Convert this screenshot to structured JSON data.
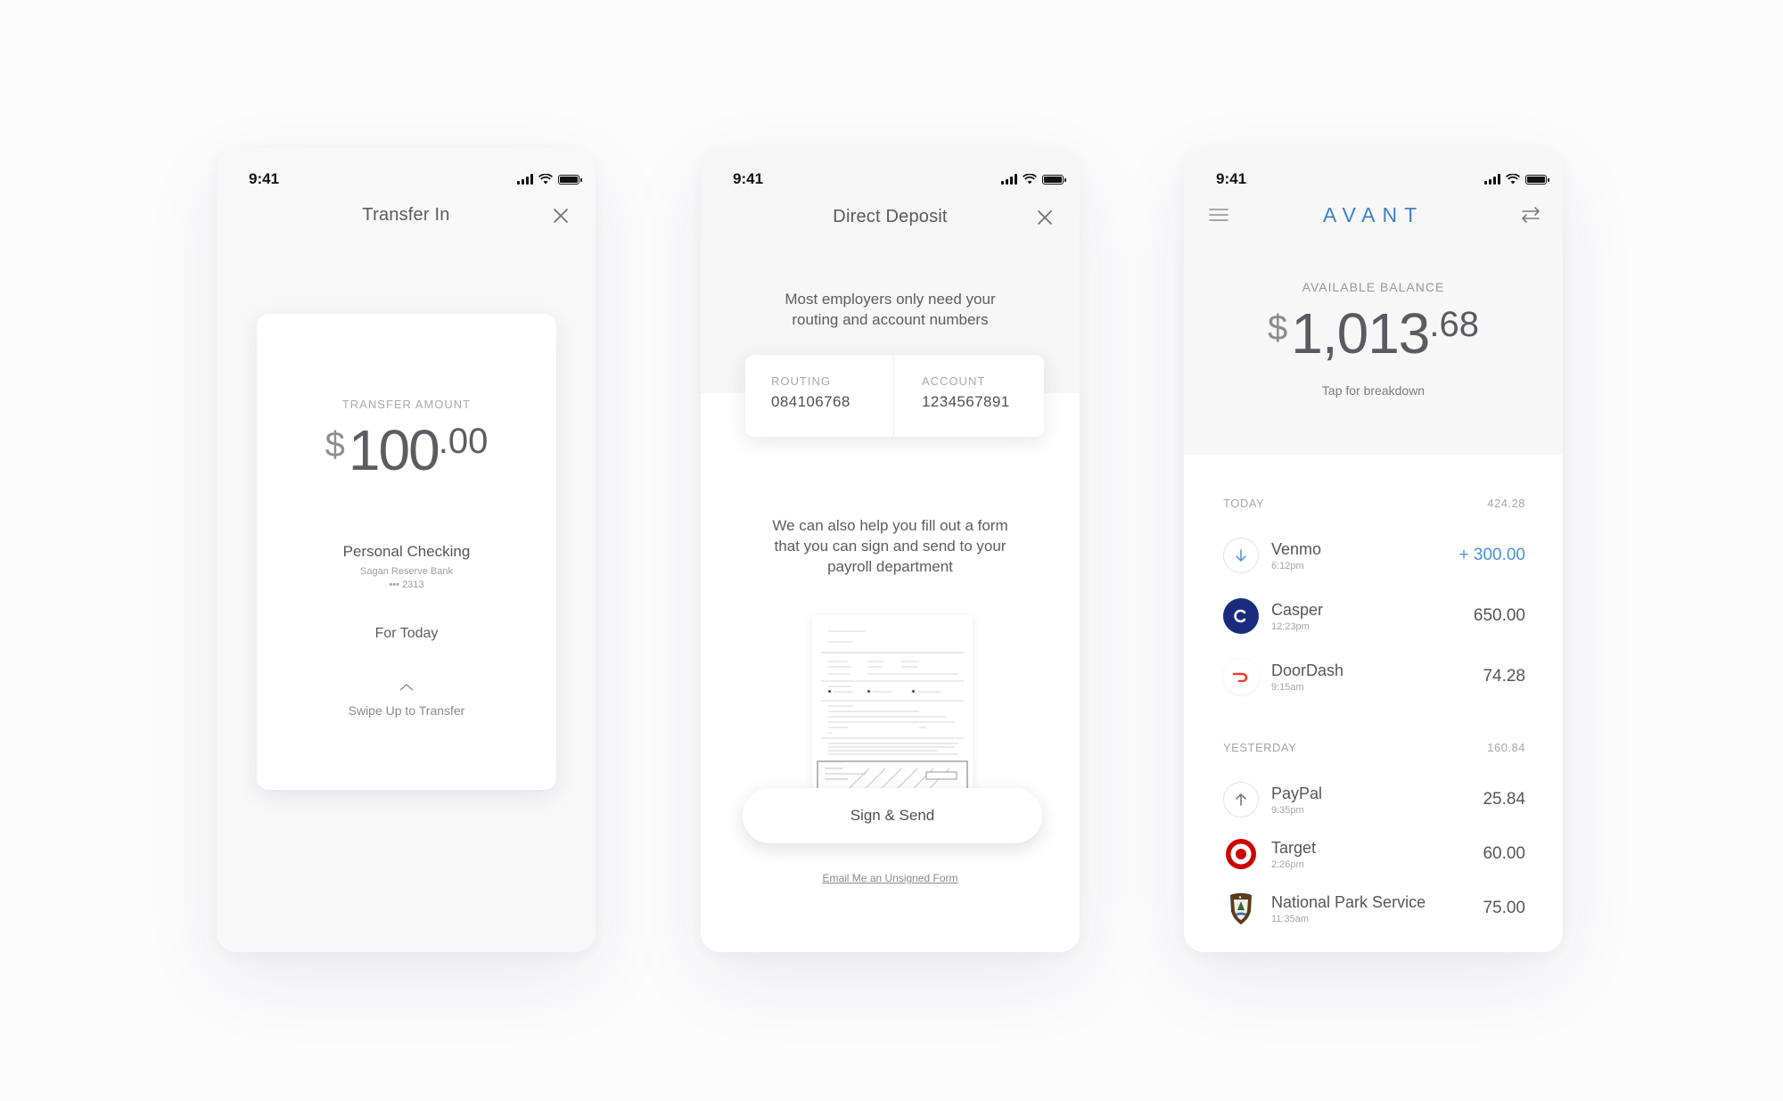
{
  "status": {
    "time": "9:41"
  },
  "transfer": {
    "title": "Transfer In",
    "amount_caption": "TRANSFER AMOUNT",
    "amount_currency": "$",
    "amount_whole": "100",
    "amount_cents": ".00",
    "account_name": "Personal Checking",
    "bank_name": "Sagan Reserve Bank",
    "account_mask": "••• 2313",
    "schedule": "For Today",
    "swipe_hint": "Swipe Up to Transfer"
  },
  "deposit": {
    "title": "Direct Deposit",
    "intro": "Most employers only need your routing and account numbers",
    "routing_label": "ROUTING",
    "routing_value": "084106768",
    "account_label": "ACCOUNT",
    "account_value": "1234567891",
    "help_text": "We can also help you fill out a form that you can sign and send to your payroll department",
    "sign_button": "Sign & Send",
    "email_link": "Email Me an Unsigned Form"
  },
  "home": {
    "logo": "AVANT",
    "balance_label": "AVAILABLE BALANCE",
    "balance_currency": "$",
    "balance_whole": "1,013",
    "balance_cents": ".68",
    "tap_breakdown": "Tap for breakdown",
    "sections": [
      {
        "label": "TODAY",
        "total": "424.28",
        "transactions": [
          {
            "name": "Venmo",
            "time": "6:12pm",
            "amount": "+ 300.00",
            "icon": "arrow-down-icon",
            "credit": true
          },
          {
            "name": "Casper",
            "time": "12:23pm",
            "amount": "650.00",
            "icon": "casper-logo-icon"
          },
          {
            "name": "DoorDash",
            "time": "9:15am",
            "amount": "74.28",
            "icon": "doordash-logo-icon"
          }
        ]
      },
      {
        "label": "YESTERDAY",
        "total": "160.84",
        "transactions": [
          {
            "name": "PayPal",
            "time": "9:35pm",
            "amount": "25.84",
            "icon": "arrow-up-icon"
          },
          {
            "name": "Target",
            "time": "2:26pm",
            "amount": "60.00",
            "icon": "target-logo-icon"
          },
          {
            "name": "National Park Service",
            "time": "11:35am",
            "amount": "75.00",
            "icon": "nps-logo-icon"
          }
        ]
      }
    ]
  },
  "colors": {
    "brand": "#3b82c4",
    "credit": "#4a90d6",
    "casper": "#1a2a7c",
    "doordash": "#ef3e2c",
    "target": "#cc0000"
  }
}
